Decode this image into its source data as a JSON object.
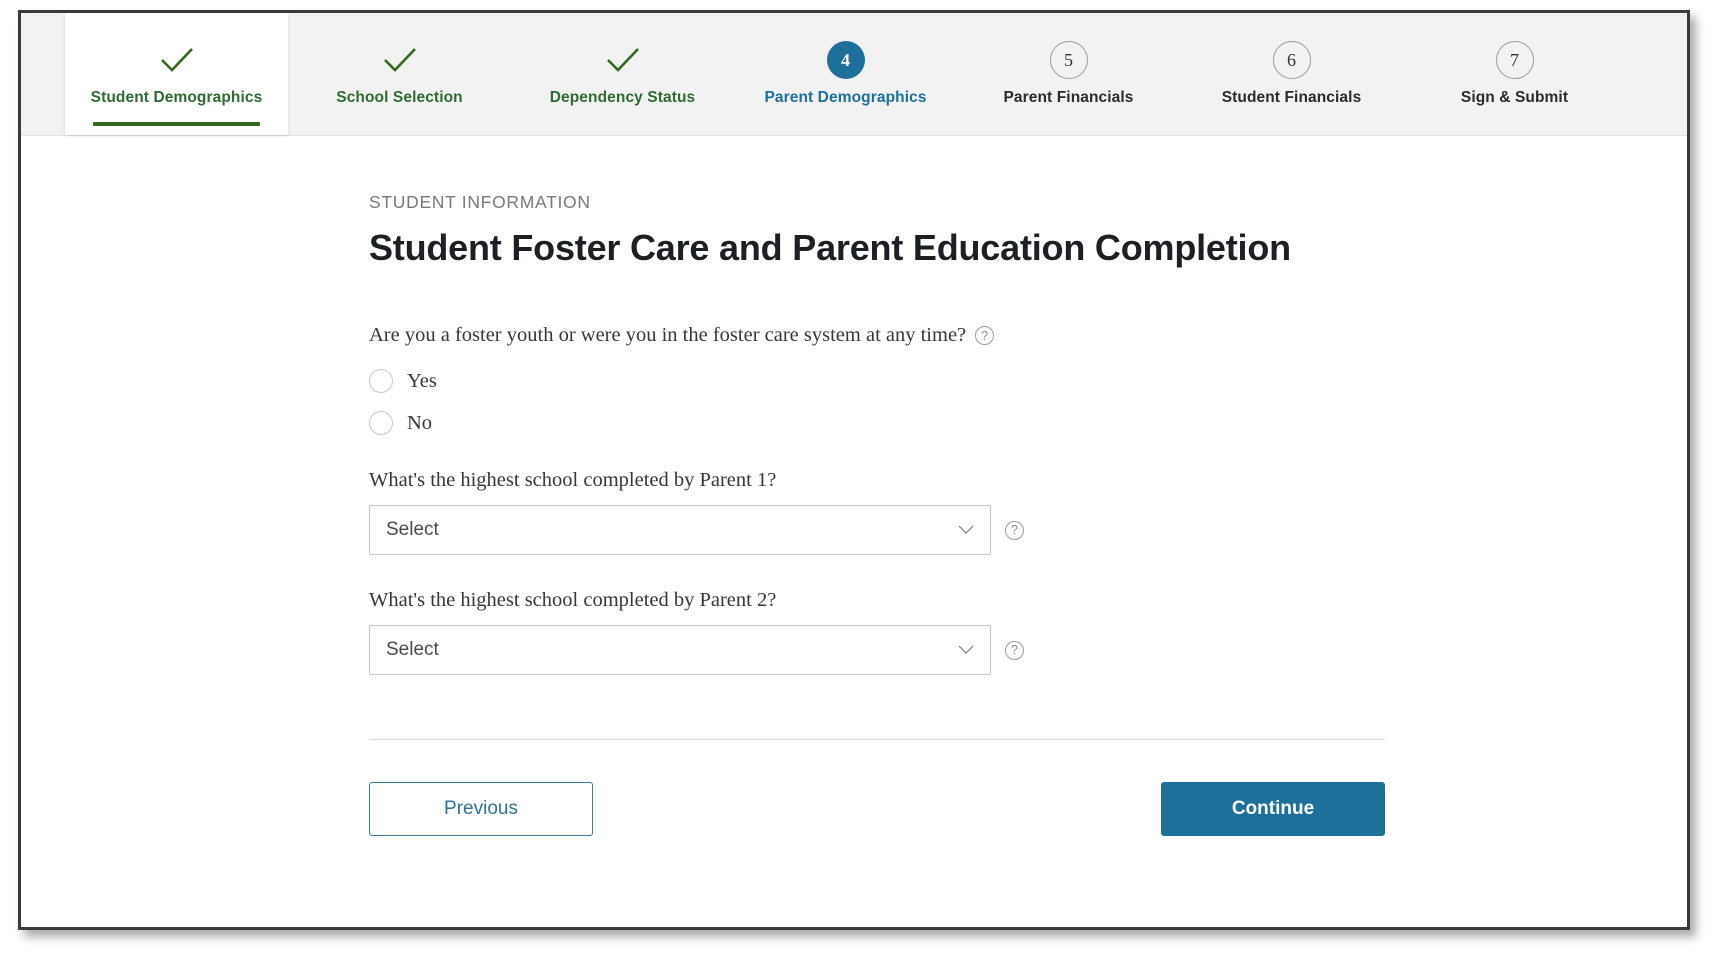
{
  "stepper": {
    "steps": [
      {
        "label": "Student Demographics",
        "state": "done",
        "marker": "check-icon",
        "number": "1"
      },
      {
        "label": "School Selection",
        "state": "done",
        "marker": "check-icon",
        "number": "2"
      },
      {
        "label": "Dependency Status",
        "state": "done",
        "marker": "check-icon",
        "number": "3"
      },
      {
        "label": "Parent Demographics",
        "state": "current",
        "marker": "number",
        "number": "4"
      },
      {
        "label": "Parent Financials",
        "state": "todo",
        "marker": "number",
        "number": "5"
      },
      {
        "label": "Student Financials",
        "state": "todo",
        "marker": "number",
        "number": "6"
      },
      {
        "label": "Sign & Submit",
        "state": "todo",
        "marker": "number",
        "number": "7"
      }
    ]
  },
  "main": {
    "eyebrow": "STUDENT INFORMATION",
    "title": "Student Foster Care and Parent Education Completion",
    "foster_question": {
      "text": "Are you a foster youth or were you in the foster care system at any time?",
      "help_glyph": "?",
      "options": [
        {
          "label": "Yes",
          "selected": false
        },
        {
          "label": "No",
          "selected": false
        }
      ]
    },
    "parent1": {
      "label": "What's the highest school completed by Parent 1?",
      "value": "Select",
      "help_glyph": "?"
    },
    "parent2": {
      "label": "What's the highest school completed by Parent 2?",
      "value": "Select",
      "help_glyph": "?"
    }
  },
  "actions": {
    "previous_label": "Previous",
    "continue_label": "Continue"
  },
  "colors": {
    "accent_blue": "#1c7099",
    "done_green": "#2f6b33",
    "underline_green": "#33691e",
    "stepper_bg": "#f2f2f2"
  }
}
